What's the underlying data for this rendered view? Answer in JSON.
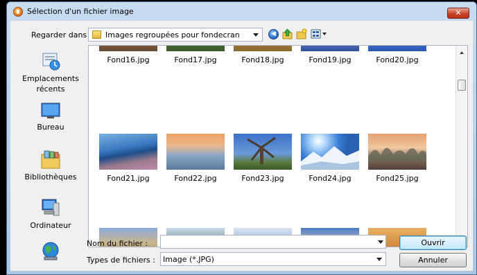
{
  "window": {
    "title": "Sélection d'un fichier image",
    "close_label": "✕"
  },
  "toolbar": {
    "look_in_label": "Regarder dans :",
    "path": "Images regroupées pour fondecran",
    "back_icon": "back-arrow-icon",
    "up_icon": "up-folder-icon",
    "new_folder_icon": "new-folder-icon",
    "views_icon": "views-menu-icon"
  },
  "places": [
    {
      "label": "Emplacements récents",
      "icon": "recent-places-icon"
    },
    {
      "label": "Bureau",
      "icon": "desktop-icon"
    },
    {
      "label": "Bibliothèques",
      "icon": "libraries-icon"
    },
    {
      "label": "Ordinateur",
      "icon": "computer-icon"
    },
    {
      "label": "",
      "icon": "network-icon"
    }
  ],
  "files": {
    "row1": [
      "Fond16.jpg",
      "Fond17.jpg",
      "Fond18.jpg",
      "Fond19.jpg",
      "Fond20.jpg"
    ],
    "row2": [
      "Fond21.jpg",
      "Fond22.jpg",
      "Fond23.jpg",
      "Fond24.jpg",
      "Fond25.jpg"
    ],
    "row3": [
      "",
      "",
      "",
      "",
      ""
    ]
  },
  "footer": {
    "filename_label": "Nom du fichier :",
    "filename_value": "",
    "filetype_label": "Types de fichiers :",
    "filetype_value": "Image (*.JPG)",
    "open_label": "Ouvrir",
    "cancel_label": "Annuler"
  }
}
